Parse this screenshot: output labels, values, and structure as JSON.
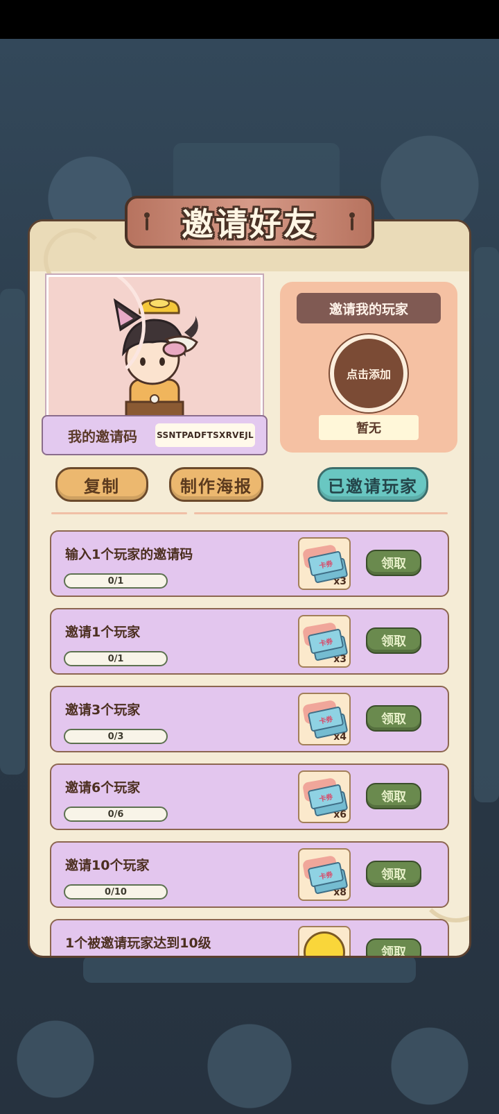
{
  "title": "邀请好友",
  "my_code": {
    "label": "我的邀请码",
    "value": "SSNTPADFTSXRVEJL"
  },
  "inviter": {
    "title": "邀请我的玩家",
    "add_label": "点击添加",
    "status": "暂无"
  },
  "buttons": {
    "copy": "复制",
    "poster": "制作海报",
    "invited": "已邀请玩家"
  },
  "tasks": [
    {
      "label": "输入1个玩家的邀请码",
      "progress": "0/1",
      "reward_icon": "ticket-icon",
      "reward_text": "卡券",
      "reward_count": "x3",
      "claim": "领取"
    },
    {
      "label": "邀请1个玩家",
      "progress": "0/1",
      "reward_icon": "ticket-icon",
      "reward_text": "卡券",
      "reward_count": "x3",
      "claim": "领取"
    },
    {
      "label": "邀请3个玩家",
      "progress": "0/3",
      "reward_icon": "ticket-icon",
      "reward_text": "卡券",
      "reward_count": "x4",
      "claim": "领取"
    },
    {
      "label": "邀请6个玩家",
      "progress": "0/6",
      "reward_icon": "ticket-icon",
      "reward_text": "卡券",
      "reward_count": "x6",
      "claim": "领取"
    },
    {
      "label": "邀请10个玩家",
      "progress": "0/10",
      "reward_icon": "ticket-icon",
      "reward_text": "卡券",
      "reward_count": "x8",
      "claim": "领取"
    },
    {
      "label": "1个被邀请玩家达到10级",
      "reward_icon": "gold-coin-icon",
      "claim": "领取"
    }
  ]
}
